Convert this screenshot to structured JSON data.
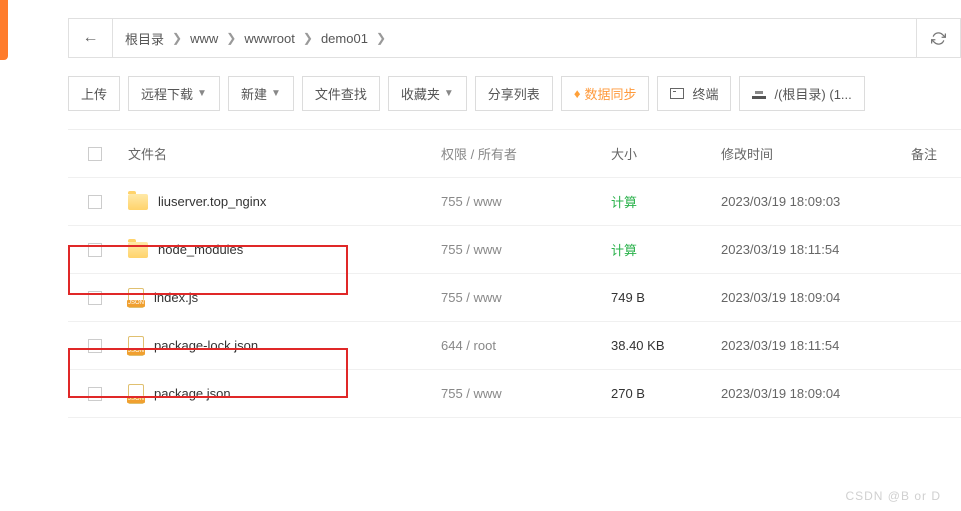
{
  "breadcrumb": {
    "root": "根目录",
    "items": [
      "www",
      "wwwroot",
      "demo01"
    ]
  },
  "toolbar": {
    "upload": "上传",
    "remote_download": "远程下载",
    "new": "新建",
    "search": "文件查找",
    "favorites": "收藏夹",
    "share": "分享列表",
    "sync": "数据同步",
    "terminal": "终端",
    "disk": "/(根目录) (1..."
  },
  "headers": {
    "name": "文件名",
    "perm": "权限 / 所有者",
    "size": "大小",
    "time": "修改时间",
    "note": "备注"
  },
  "rows": [
    {
      "type": "folder",
      "name": "liuserver.top_nginx",
      "perm": "755 / www",
      "size": "计算",
      "size_calc": true,
      "time": "2023/03/19 18:09:03"
    },
    {
      "type": "folder",
      "name": "node_modules",
      "perm": "755 / www",
      "size": "计算",
      "size_calc": true,
      "time": "2023/03/19 18:11:54"
    },
    {
      "type": "file",
      "name": "index.js",
      "perm": "755 / www",
      "size": "749 B",
      "size_calc": false,
      "time": "2023/03/19 18:09:04"
    },
    {
      "type": "file",
      "name": "package-lock.json",
      "perm": "644 / root",
      "size": "38.40 KB",
      "size_calc": false,
      "time": "2023/03/19 18:11:54"
    },
    {
      "type": "file",
      "name": "package.json",
      "perm": "755 / www",
      "size": "270 B",
      "size_calc": false,
      "time": "2023/03/19 18:09:04"
    }
  ],
  "watermark": "CSDN @B   or  D"
}
